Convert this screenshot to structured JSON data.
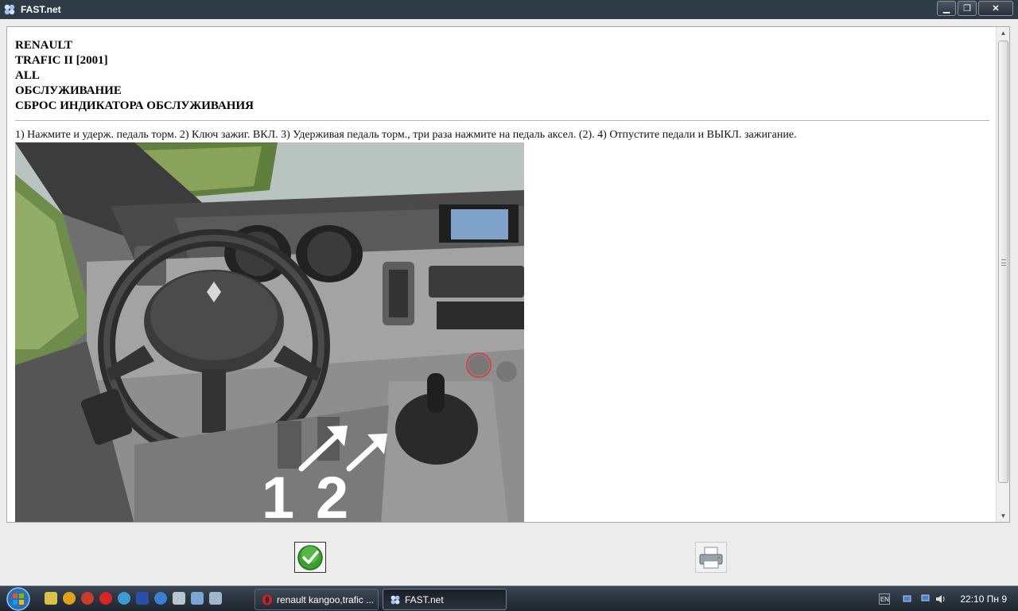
{
  "window": {
    "title": "FAST.net",
    "minimize_glyph": "▁",
    "maximize_glyph": "❐",
    "close_glyph": "✕"
  },
  "document": {
    "header_lines": [
      "RENAULT",
      "TRAFIC II [2001]",
      "ALL",
      "ОБСЛУЖИВАНИЕ",
      "СБРОС ИНДИКАТОРА ОБСЛУЖИВАНИЯ"
    ],
    "instruction": "1) Нажмите и удерж. педаль торм. 2) Ключ зажиг. ВКЛ. 3) Удерживая педаль торм., три раза нажмите на педаль аксел. (2). 4) Отпустите педали и ВЫКЛ. зажигание.",
    "photo_labels": [
      "1",
      "2"
    ]
  },
  "buttons": {
    "ok_icon": "checkmark-icon",
    "print_icon": "printer-icon"
  },
  "taskbar": {
    "tasks": [
      {
        "label": "renault kangoo,trafic ...",
        "icon": "opera-icon"
      },
      {
        "label": "FAST.net",
        "icon": "fast-net-icon"
      }
    ],
    "language": "EN",
    "clock": "22:10 Пн 9"
  },
  "colors": {
    "titlebar": "#2f3a47",
    "ok_green": "#3aa12f",
    "taskbar": "#1d242d"
  }
}
